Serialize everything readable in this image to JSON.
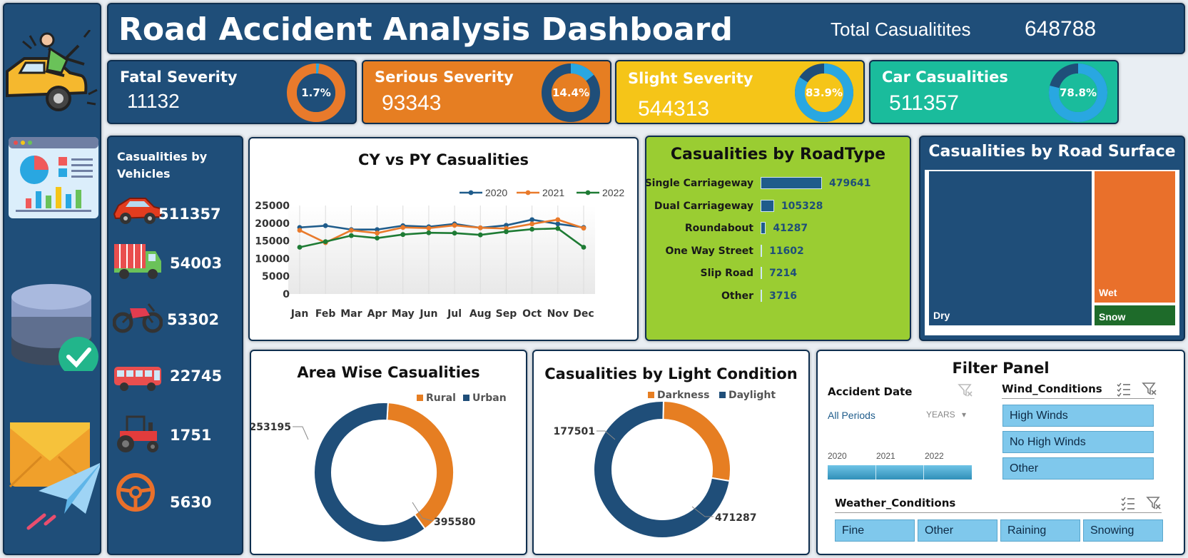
{
  "header": {
    "title": "Road Accident Analysis Dashboard",
    "total_label": "Total Casualitites",
    "total_value": "648788"
  },
  "kpis": [
    {
      "title": "Fatal Severity",
      "value": "11132",
      "pct": "1.7%",
      "fraction": 0.017,
      "bg": "#1f4e79",
      "ring": "#e97a2b",
      "slice": "#29a7e1",
      "inner": "#1f4e79"
    },
    {
      "title": "Serious Severity",
      "value": "93343",
      "pct": "14.4%",
      "fraction": 0.144,
      "bg": "#e67e22",
      "ring": "#1f4e79",
      "slice": "#29a7e1",
      "inner": "#e67e22"
    },
    {
      "title": "Slight Severity",
      "value": "544313",
      "pct": "83.9%",
      "fraction": 0.839,
      "bg": "#f5c518",
      "ring": "#1f4e79",
      "slice": "#29a7e1",
      "inner": "#f5c518"
    },
    {
      "title": "Car Casualities",
      "value": "511357",
      "pct": "78.8%",
      "fraction": 0.788,
      "bg": "#1abc9c",
      "ring": "#1f4e79",
      "slice": "#29a7e1",
      "inner": "#1abc9c"
    }
  ],
  "vehicles": {
    "title": "Casualities by Vehicles",
    "items": [
      {
        "icon": "car-icon",
        "value": "511357"
      },
      {
        "icon": "truck-icon",
        "value": "54003"
      },
      {
        "icon": "motorcycle-icon",
        "value": "53302"
      },
      {
        "icon": "bus-icon",
        "value": "22745"
      },
      {
        "icon": "tractor-icon",
        "value": "1751"
      },
      {
        "icon": "steering-wheel-icon",
        "value": "5630"
      }
    ]
  },
  "chart_data": [
    {
      "type": "line",
      "title": "CY vs PY Casualities",
      "categories": [
        "Jan",
        "Feb",
        "Mar",
        "Apr",
        "May",
        "Jun",
        "Jul",
        "Aug",
        "Sep",
        "Oct",
        "Nov",
        "Dec"
      ],
      "ylim": [
        0,
        25000
      ],
      "yticks": [
        "25000",
        "20000",
        "15000",
        "10000",
        "5000",
        "0"
      ],
      "grid": true,
      "legend": "top-right",
      "series": [
        {
          "name": "2020",
          "color": "#1f5c8b",
          "values": [
            18800,
            19300,
            18200,
            18200,
            19300,
            19000,
            19800,
            18700,
            19400,
            21000,
            19800,
            18800
          ]
        },
        {
          "name": "2021",
          "color": "#e97a2b",
          "values": [
            18000,
            14500,
            18000,
            17200,
            18800,
            18600,
            19400,
            18700,
            18500,
            19800,
            21000,
            18600
          ]
        },
        {
          "name": "2022",
          "color": "#1e7b34",
          "values": [
            13200,
            14800,
            16500,
            15800,
            16800,
            17300,
            17200,
            16700,
            17600,
            18300,
            18500,
            13200
          ]
        }
      ]
    },
    {
      "type": "bar",
      "title": "Casualities by RoadType",
      "categories": [
        "Single Carriageway",
        "Dual Carriageway",
        "Roundabout",
        "One Way Street",
        "Slip Road",
        "Other"
      ],
      "values": [
        479641,
        105328,
        41287,
        11602,
        7214,
        3716
      ],
      "labels": [
        "479641",
        "105328",
        "41287",
        "11602",
        "7214",
        "3716"
      ]
    },
    {
      "type": "heatmap",
      "title": "Casualities by Road Surface",
      "categories": [
        "Dry",
        "Wet",
        "Snow"
      ]
    },
    {
      "type": "pie",
      "title": "Area Wise Casualities",
      "legend": "top-right",
      "categories": [
        "Rural",
        "Urban"
      ],
      "values": [
        253195,
        395580
      ],
      "labels": [
        "253195",
        "395580"
      ],
      "colors": [
        "#e67e22",
        "#1f4e79"
      ]
    },
    {
      "type": "pie",
      "title": "Casualities by Light Condition",
      "legend": "top",
      "categories": [
        "Darkness",
        "Daylight"
      ],
      "values": [
        177501,
        471287
      ],
      "labels": [
        "177501",
        "471287"
      ],
      "colors": [
        "#e67e22",
        "#1f4e79"
      ]
    }
  ],
  "filter": {
    "title": "Filter Panel",
    "date": {
      "label": "Accident Date",
      "period": "All Periods",
      "unit": "YEARS",
      "years": [
        "2020",
        "2021",
        "2022"
      ]
    },
    "wind": {
      "label": "Wind_Conditions",
      "options": [
        "High Winds",
        "No High Winds",
        "Other"
      ]
    },
    "weather": {
      "label": "Weather_Conditions",
      "options": [
        "Fine",
        "Other",
        "Raining",
        "Snowing"
      ]
    }
  },
  "sidebar": {
    "icons": [
      "car-crash-icon",
      "dashboard-chart-icon",
      "database-check-icon",
      "mail-send-icon"
    ]
  }
}
